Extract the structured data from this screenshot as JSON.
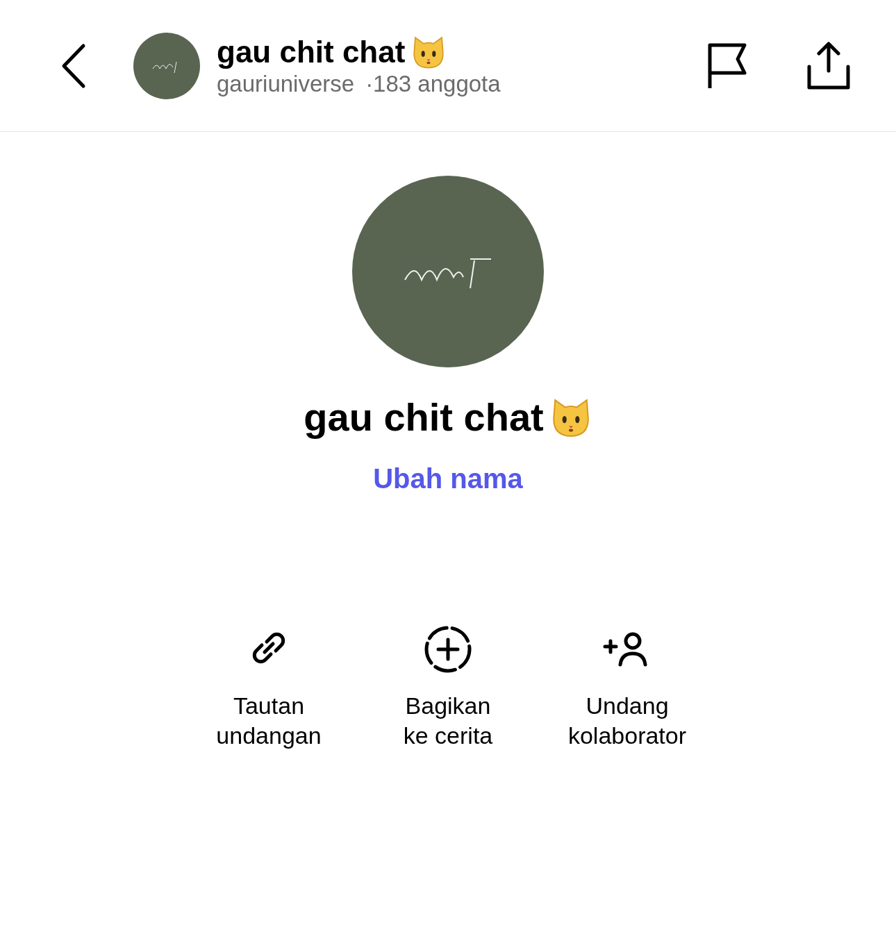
{
  "header": {
    "title": "gau chit chat",
    "username": "gauriuniverse",
    "members": "·183 anggota"
  },
  "group_name": "gau chit chat",
  "rename_link": "Ubah nama",
  "actions": [
    {
      "kind": "link",
      "lines": [
        "Tautan",
        "undangan"
      ]
    },
    {
      "kind": "story",
      "lines": [
        "Bagikan",
        "ke cerita"
      ]
    },
    {
      "kind": "invite",
      "lines": [
        "Undang",
        "kolaborator"
      ]
    }
  ]
}
